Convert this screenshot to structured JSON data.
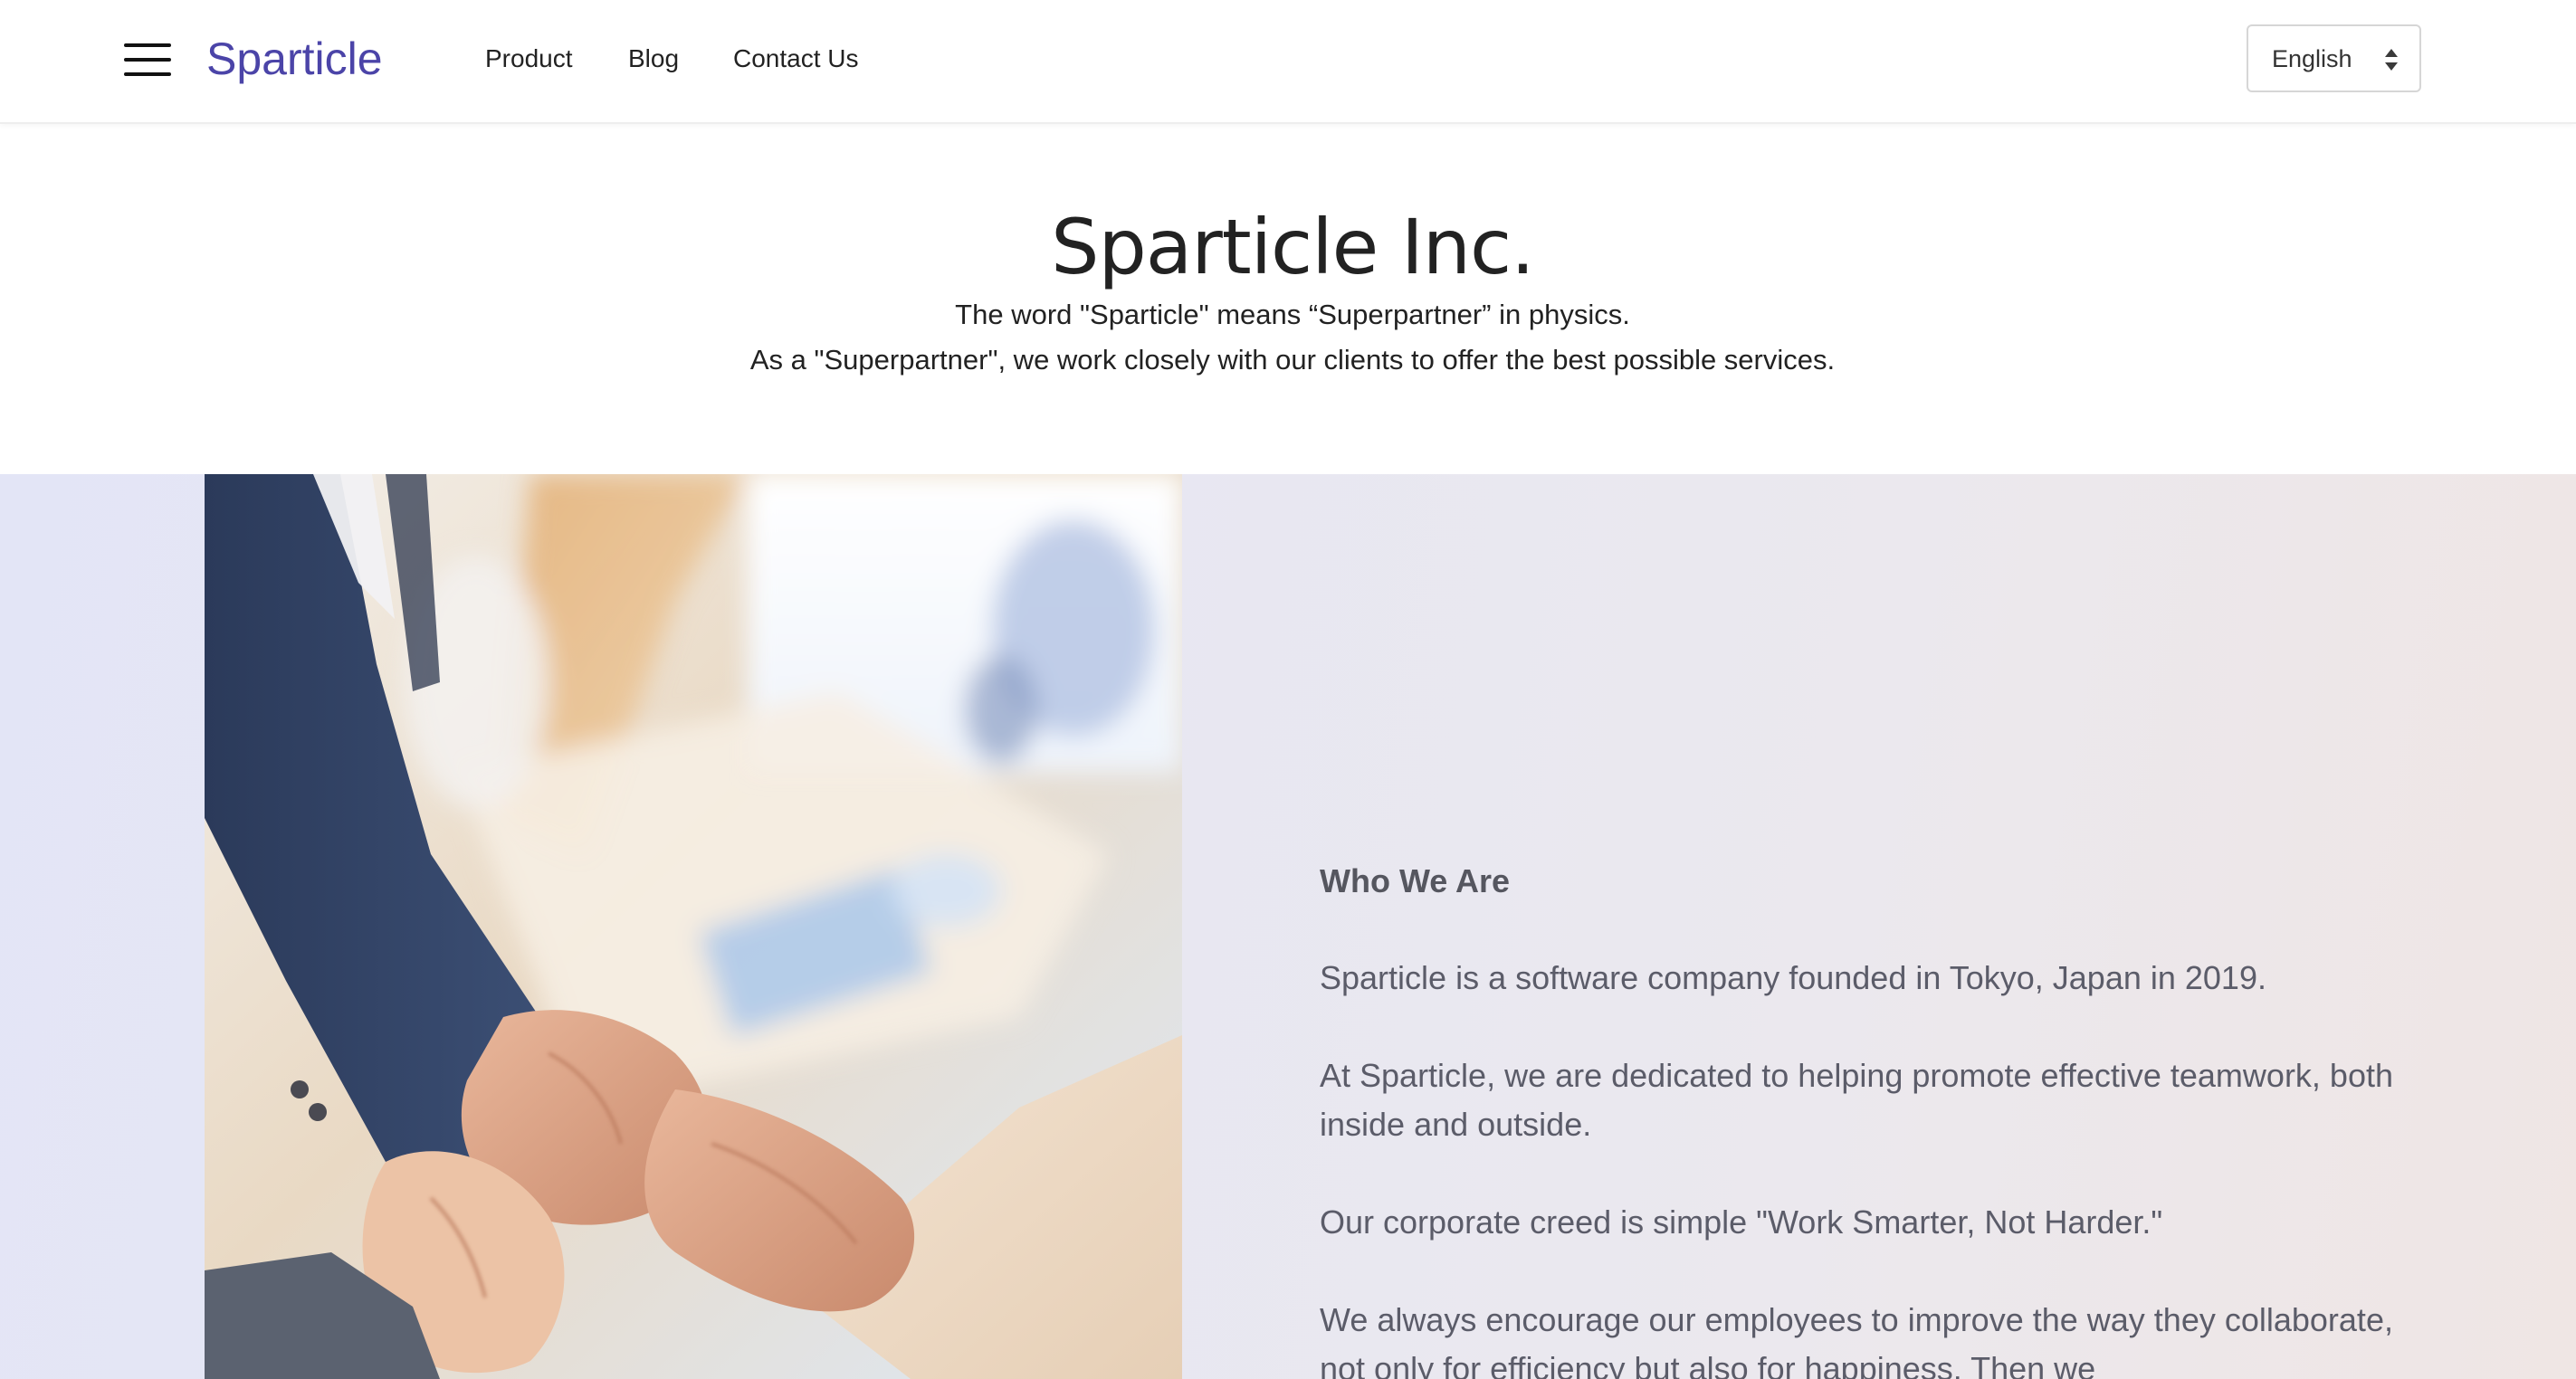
{
  "header": {
    "brand": "Sparticle",
    "nav": [
      {
        "label": "Product"
      },
      {
        "label": "Blog"
      },
      {
        "label": "Contact Us"
      }
    ],
    "language": {
      "selected": "English"
    }
  },
  "intro": {
    "title": "Sparticle Inc.",
    "line1": "The word \"Sparticle\" means “Superpartner” in physics.",
    "line2": "As a \"Superpartner\", we work closely with our clients to offer the best possible services."
  },
  "about": {
    "heading": "Who We Are",
    "paragraphs": [
      "Sparticle is a software company founded in Tokyo, Japan in 2019.",
      "At Sparticle, we are dedicated to helping promote effective teamwork, both inside and outside.",
      "Our corporate creed is simple \"Work Smarter, Not Harder.\"",
      "We always encourage our employees to improve the way they collaborate, not only for efficiency but also for happiness. Then we"
    ]
  },
  "colors": {
    "brand": "#4b44a8",
    "text": "#222222",
    "muted_text": "#5b5c69",
    "section_bg": "#e6e6f3"
  }
}
